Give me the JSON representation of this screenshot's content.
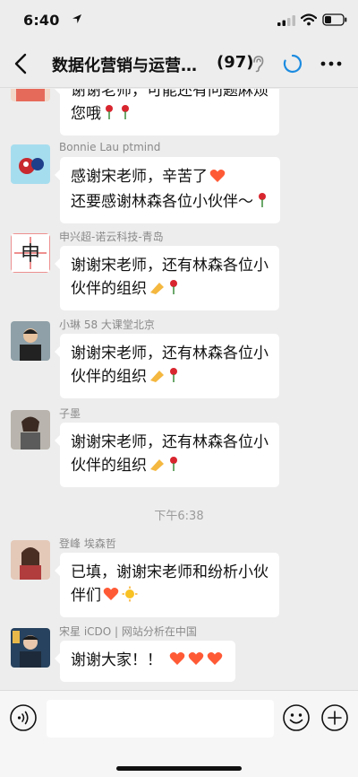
{
  "status_bar": {
    "time": "6:40"
  },
  "nav": {
    "title": "数据化营销与运营…",
    "member_count": "(97)"
  },
  "messages": [
    {
      "sender": "",
      "lines": [
        "谢谢老师，可能还有问题麻烦",
        "您哦"
      ],
      "emoji": "🌹🌹"
    },
    {
      "sender": "Bonnie Lau ptmind",
      "lines": [
        "感谢宋老师，辛苦了",
        "还要感谢林森各位小伙伴～"
      ],
      "emoji_line1": "❤",
      "emoji": "🌹"
    },
    {
      "sender": "申兴超-诺云科技-青岛",
      "lines": [
        "谢谢宋老师，还有林森各位小",
        "伙伴的组织"
      ],
      "emoji": "👏🌹"
    },
    {
      "sender": "小琳 58 大课堂北京",
      "lines": [
        "谢谢宋老师，还有林森各位小",
        "伙伴的组织"
      ],
      "emoji": "👏🌹"
    },
    {
      "sender": "子墨",
      "lines": [
        "谢谢宋老师，还有林森各位小",
        "伙伴的组织"
      ],
      "emoji": "👏🌹"
    },
    {
      "sender": "登峰 埃森哲",
      "lines": [
        "已填，谢谢宋老师和纷析小伙",
        "伴们"
      ],
      "emoji": "❤🌞"
    },
    {
      "sender": "宋星 iCDO | 网站分析在中国",
      "lines": [
        "谢谢大家！！"
      ],
      "emoji": "❤❤❤"
    }
  ],
  "time_separator": "下午6:38",
  "input": {
    "value": "",
    "placeholder": ""
  },
  "icons": [
    "back-icon",
    "ear-icon",
    "sync-icon",
    "more-icon",
    "voice-icon",
    "emoji-icon",
    "plus-icon"
  ],
  "colors": {
    "background": "#ededed",
    "bubble": "#ffffff",
    "sender": "#8a8a8a",
    "heart": "#ff5a36"
  }
}
